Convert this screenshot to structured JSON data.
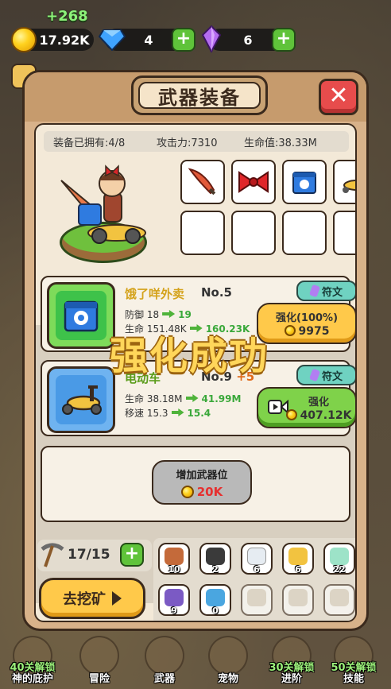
{
  "top_bar": {
    "gain": "+268",
    "gold": "17.92K",
    "gems": "4",
    "crystals": "6"
  },
  "panel": {
    "title": "武器装备",
    "stats": {
      "owned": "装备已拥有:4/8",
      "attack": "攻击力:7310",
      "hp": "生命值:38.33M"
    }
  },
  "cards": [
    {
      "name": "饿了咩外卖",
      "level": "No.5",
      "stat1_label": "防御 18",
      "stat1_new": "19",
      "stat2_label": "生命 151.48K",
      "stat2_new": "160.23K",
      "rune_label": "符文",
      "action_label": "强化(100%)",
      "cost": "9975"
    },
    {
      "name": "电动车",
      "level": "No.9",
      "level_bonus": "+5",
      "stat1_label": "生命 38.18M",
      "stat1_new": "41.99M",
      "stat2_label": "移速 15.3",
      "stat2_new": "15.4",
      "rune_label": "符文",
      "action_label": "强化",
      "cost": "407.12K"
    }
  ],
  "success_text": "强化成功",
  "add_slot": {
    "label": "增加武器位",
    "cost": "20K"
  },
  "mining": {
    "pickaxe": "17/15",
    "go_mine": "去挖矿"
  },
  "ores": [
    "10",
    "2",
    "6",
    "6",
    "22",
    "9",
    "0"
  ],
  "nav": [
    {
      "line1": "40关解锁",
      "line2": "神的庇护"
    },
    {
      "line1": "",
      "line2": "冒险"
    },
    {
      "line1": "",
      "line2": "武器"
    },
    {
      "line1": "",
      "line2": "宠物"
    },
    {
      "line1": "30关解锁",
      "line2": "进阶"
    },
    {
      "line1": "50关解锁",
      "line2": "技能"
    }
  ],
  "colors": {
    "panel": "#d8b28a",
    "close": "#e74c4c",
    "rune": "#6fd2c1",
    "upgrade_gold": "#ffc94a",
    "upgrade_green": "#7fd24a"
  }
}
